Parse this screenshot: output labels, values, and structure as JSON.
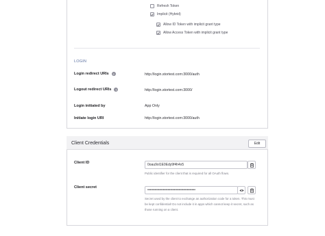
{
  "grant_types": {
    "refresh_token": {
      "label": "Refresh Token",
      "checked": false
    },
    "implicit": {
      "label": "Implicit (Hybrid)",
      "checked": true
    },
    "allow_id_token": {
      "label": "Allow ID Token with implicit grant type",
      "checked": true
    },
    "allow_access_token": {
      "label": "Allow Access Token with implicit grant type",
      "checked": true
    }
  },
  "login": {
    "section_label": "LOGIN",
    "redirect_uris": {
      "label": "Login redirect URIs",
      "value": "http://login.stortest.com:3000/auth"
    },
    "logout_redirect_uris": {
      "label": "Logout redirect URIs",
      "value": "http://login.stortest.com:3000/"
    },
    "initiated_by": {
      "label": "Login initiated by",
      "value": "App Only"
    },
    "initiate_uri": {
      "label": "Initiate login URI",
      "value": "http://login.stortest.com:3000/auth"
    }
  },
  "client_credentials": {
    "title": "Client Credentials",
    "edit_label": "Edit",
    "client_id": {
      "label": "Client ID",
      "value": "0oau9ol1E0Edy9f4h4x5",
      "help": "Public identifier for the client that is required for all OAuth flows."
    },
    "client_secret": {
      "label": "Client secret",
      "value": "••••••••••••••••••••••••••••••••••••••••",
      "help": "Secret used by the client to exchange an authorization code for a token. This must be kept confidential! Do not include it in apps which cannot keep it secret, such as those running on a client."
    }
  },
  "icons": {
    "info": "info-icon",
    "copy": "clipboard-icon",
    "reveal": "eye-icon",
    "checkmark": "checkmark-icon"
  }
}
